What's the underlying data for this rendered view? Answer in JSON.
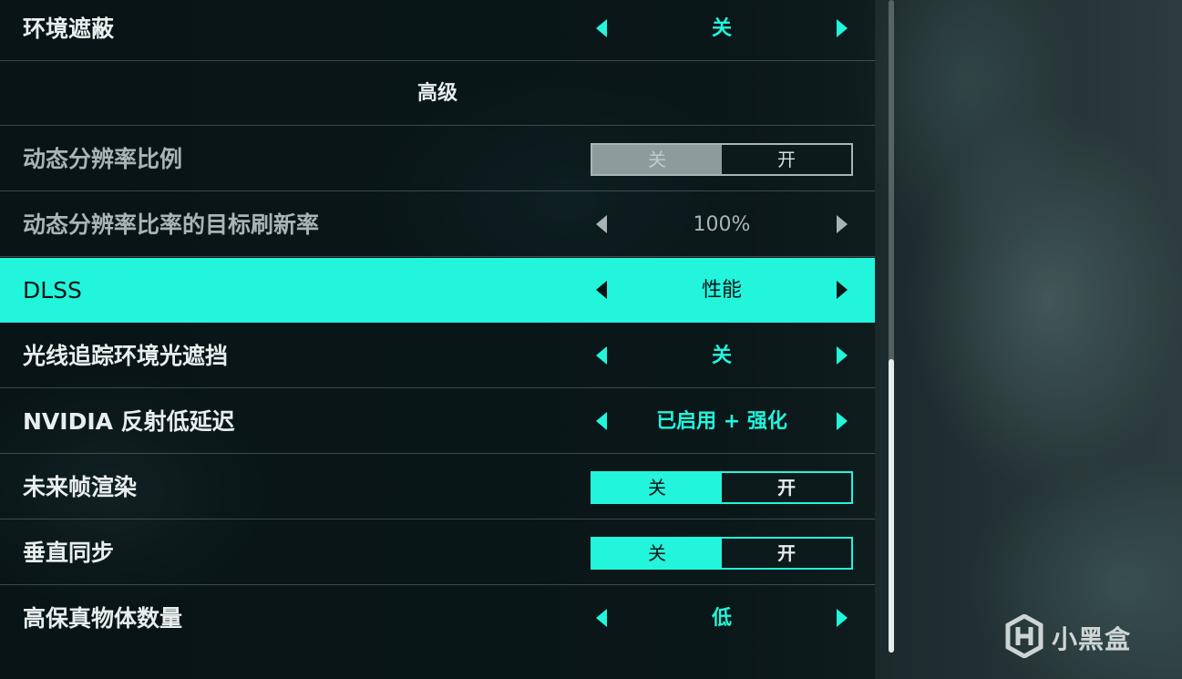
{
  "settings": {
    "ambient_occlusion": {
      "label": "环境遮蔽",
      "value": "关"
    },
    "section_advanced": {
      "title": "高级"
    },
    "dynamic_resolution_scale": {
      "label": "动态分辨率比例",
      "off": "关",
      "on": "开",
      "selected": "关",
      "disabled": true
    },
    "dynamic_resolution_target": {
      "label": "动态分辨率比率的目标刷新率",
      "value": "100%",
      "disabled": true
    },
    "dlss": {
      "label": "DLSS",
      "value": "性能",
      "highlighted": true
    },
    "rt_ambient_occlusion": {
      "label": "光线追踪环境光遮挡",
      "value": "关"
    },
    "nvidia_reflex": {
      "label": "NVIDIA 反射低延迟",
      "value": "已启用 + 强化"
    },
    "future_frame_rendering": {
      "label": "未来帧渲染",
      "off": "关",
      "on": "开",
      "selected": "关"
    },
    "vsync": {
      "label": "垂直同步",
      "off": "关",
      "on": "开",
      "selected": "关"
    },
    "hifi_object_count": {
      "label": "高保真物体数量",
      "value": "低"
    }
  },
  "scrollbar": {
    "position_fraction": 0.55
  },
  "watermark": {
    "text": "小黑盒",
    "icon": "heybox-logo-icon"
  },
  "colors": {
    "accent": "#22f5dc",
    "text": "#e8eeee",
    "dim_text": "#aab4b4",
    "dark_text": "#0b1516"
  }
}
